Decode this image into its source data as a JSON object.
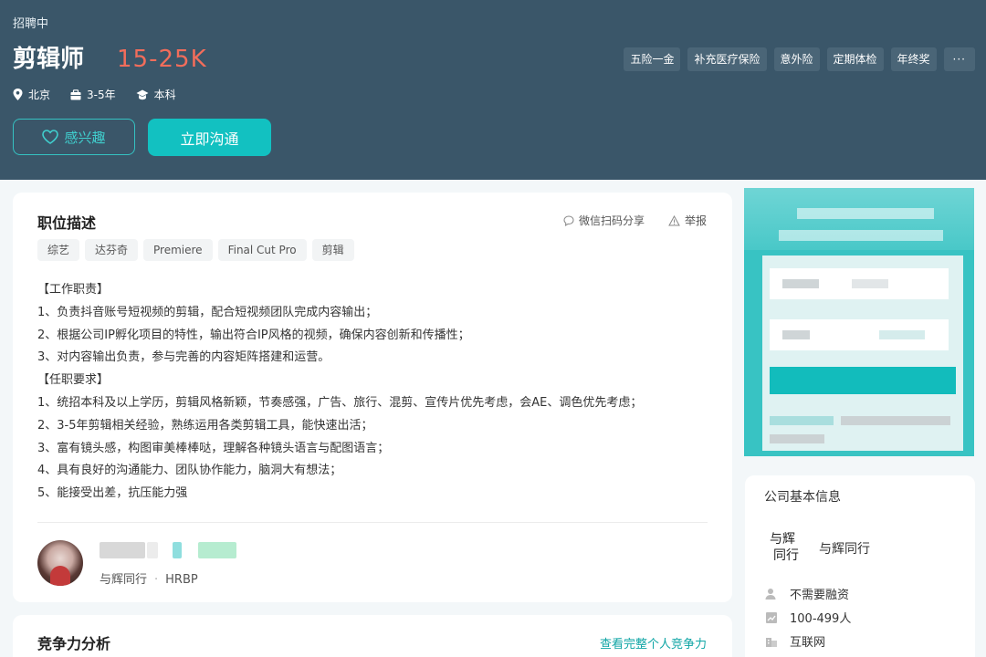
{
  "header": {
    "status": "招聘中",
    "job_title": "剪辑师",
    "salary": "15-25K",
    "location": "北京",
    "experience": "3-5年",
    "education": "本科",
    "benefits": [
      "五险一金",
      "补充医疗保险",
      "意外险",
      "定期体检",
      "年终奖"
    ],
    "more_label": "···",
    "interest_label": "感兴趣",
    "chat_label": "立即沟通"
  },
  "description": {
    "title": "职位描述",
    "share_label": "微信扫码分享",
    "report_label": "举报",
    "tags": [
      "综艺",
      "达芬奇",
      "Premiere",
      "Final Cut Pro",
      "剪辑"
    ],
    "lines": [
      "【工作职责】",
      "1、负责抖音账号短视频的剪辑，配合短视频团队完成内容输出；",
      "2、根据公司IP孵化项目的特性，输出符合IP风格的视频，确保内容创新和传播性；",
      "3、对内容输出负责，参与完善的内容矩阵搭建和运营。",
      "【任职要求】",
      "1、统招本科及以上学历，剪辑风格新颖，节奏感强，广告、旅行、混剪、宣传片优先考虑，会AE、调色优先考虑；",
      "2、3-5年剪辑相关经验，熟练运用各类剪辑工具，能快速出活；",
      "3、富有镜头感，构图审美棒棒哒，理解各种镜头语言与配图语言；",
      "4、具有良好的沟通能力、团队协作能力，脑洞大有想法；",
      "5、能接受出差，抗压能力强"
    ],
    "recruiter": {
      "company": "与辉同行",
      "separator": "·",
      "role": "HRBP"
    }
  },
  "competition": {
    "title": "竞争力分析",
    "link_label": "查看完整个人竞争力"
  },
  "company": {
    "title": "公司基本信息",
    "name": "与辉同行",
    "logo_text": "与辉同行",
    "funding": "不需要融资",
    "size": "100-499人",
    "industry": "互联网"
  },
  "colors": {
    "header_bg": "#3a5669",
    "salary": "#f26d5b",
    "accent": "#12c1c1"
  }
}
